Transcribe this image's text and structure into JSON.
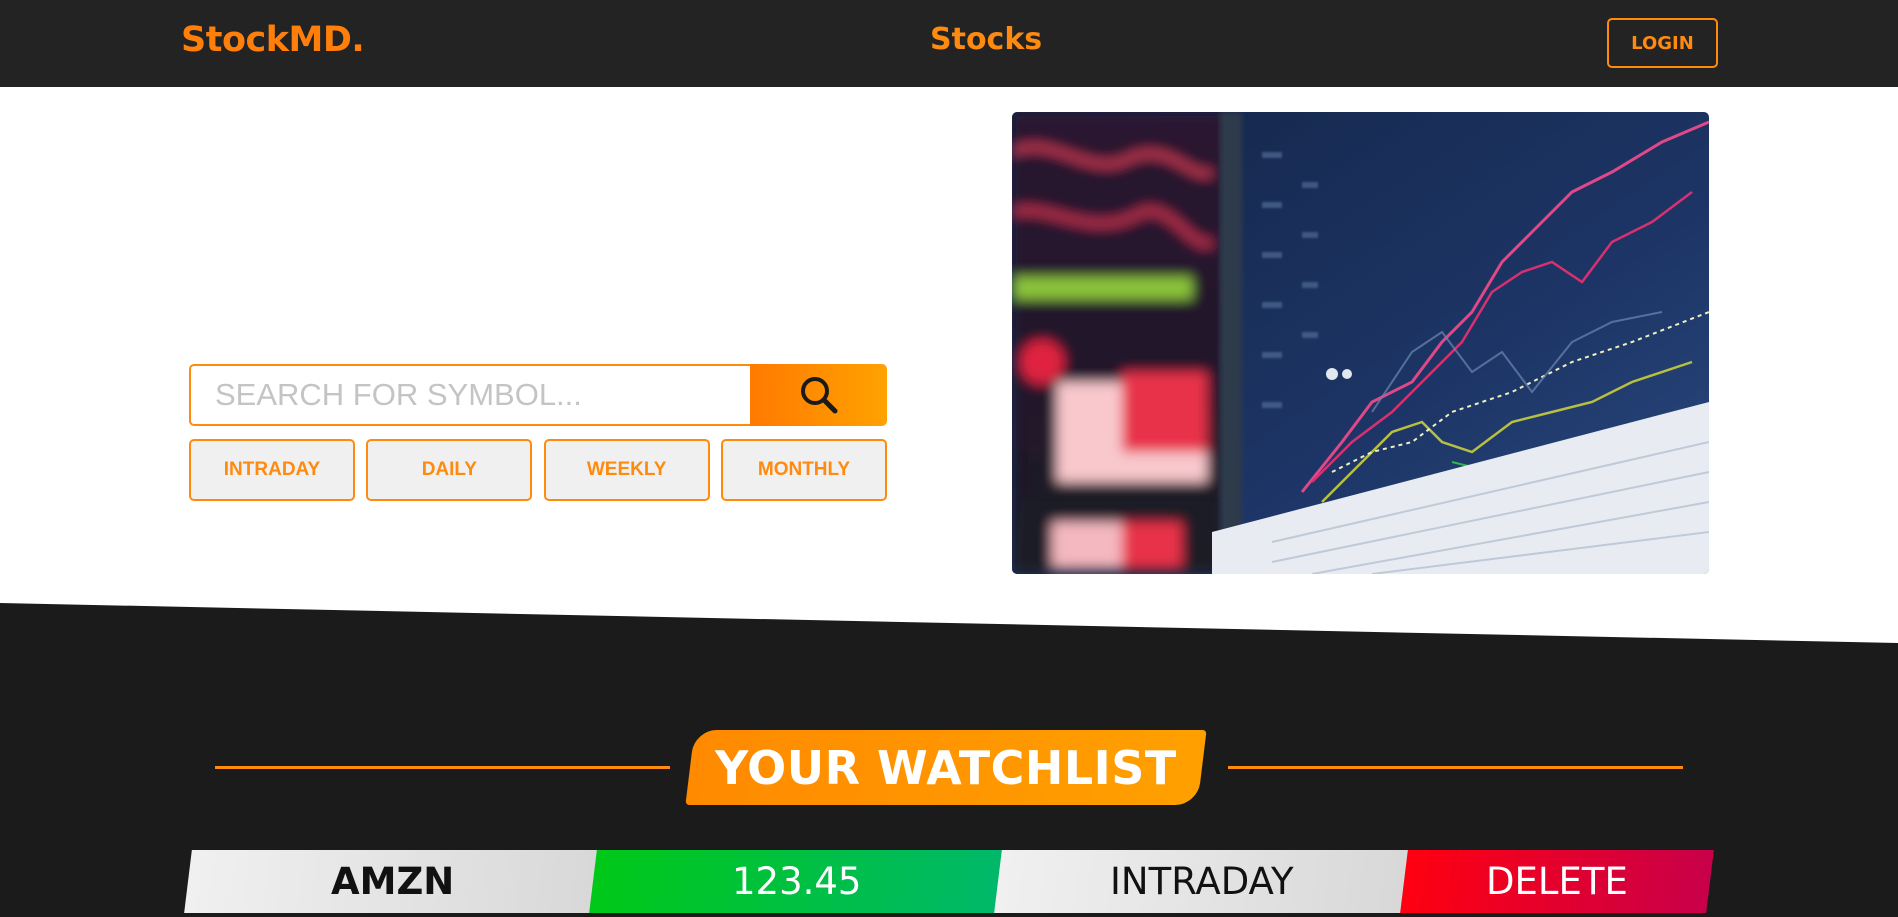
{
  "navbar": {
    "brand": "StockMD.",
    "center_title": "Stocks",
    "login_label": "LOGIN"
  },
  "search": {
    "placeholder": "SEARCH FOR SYMBOL...",
    "button_icon": "search-icon"
  },
  "ranges": [
    "INTRADAY",
    "DAILY",
    "WEEKLY",
    "MONTHLY"
  ],
  "hero_image": "stock-chart-screen",
  "watchlist": {
    "title": "YOUR WATCHLIST",
    "rows": [
      {
        "symbol": "AMZN",
        "price": "123.45",
        "range": "INTRADAY",
        "delete_label": "DELETE"
      }
    ]
  },
  "colors": {
    "accent": "#ff8a10",
    "navbar_bg": "#232323",
    "page_dark_bg": "#1b1b1b",
    "price_green": "#00c818",
    "delete_red": "#ff0010"
  }
}
